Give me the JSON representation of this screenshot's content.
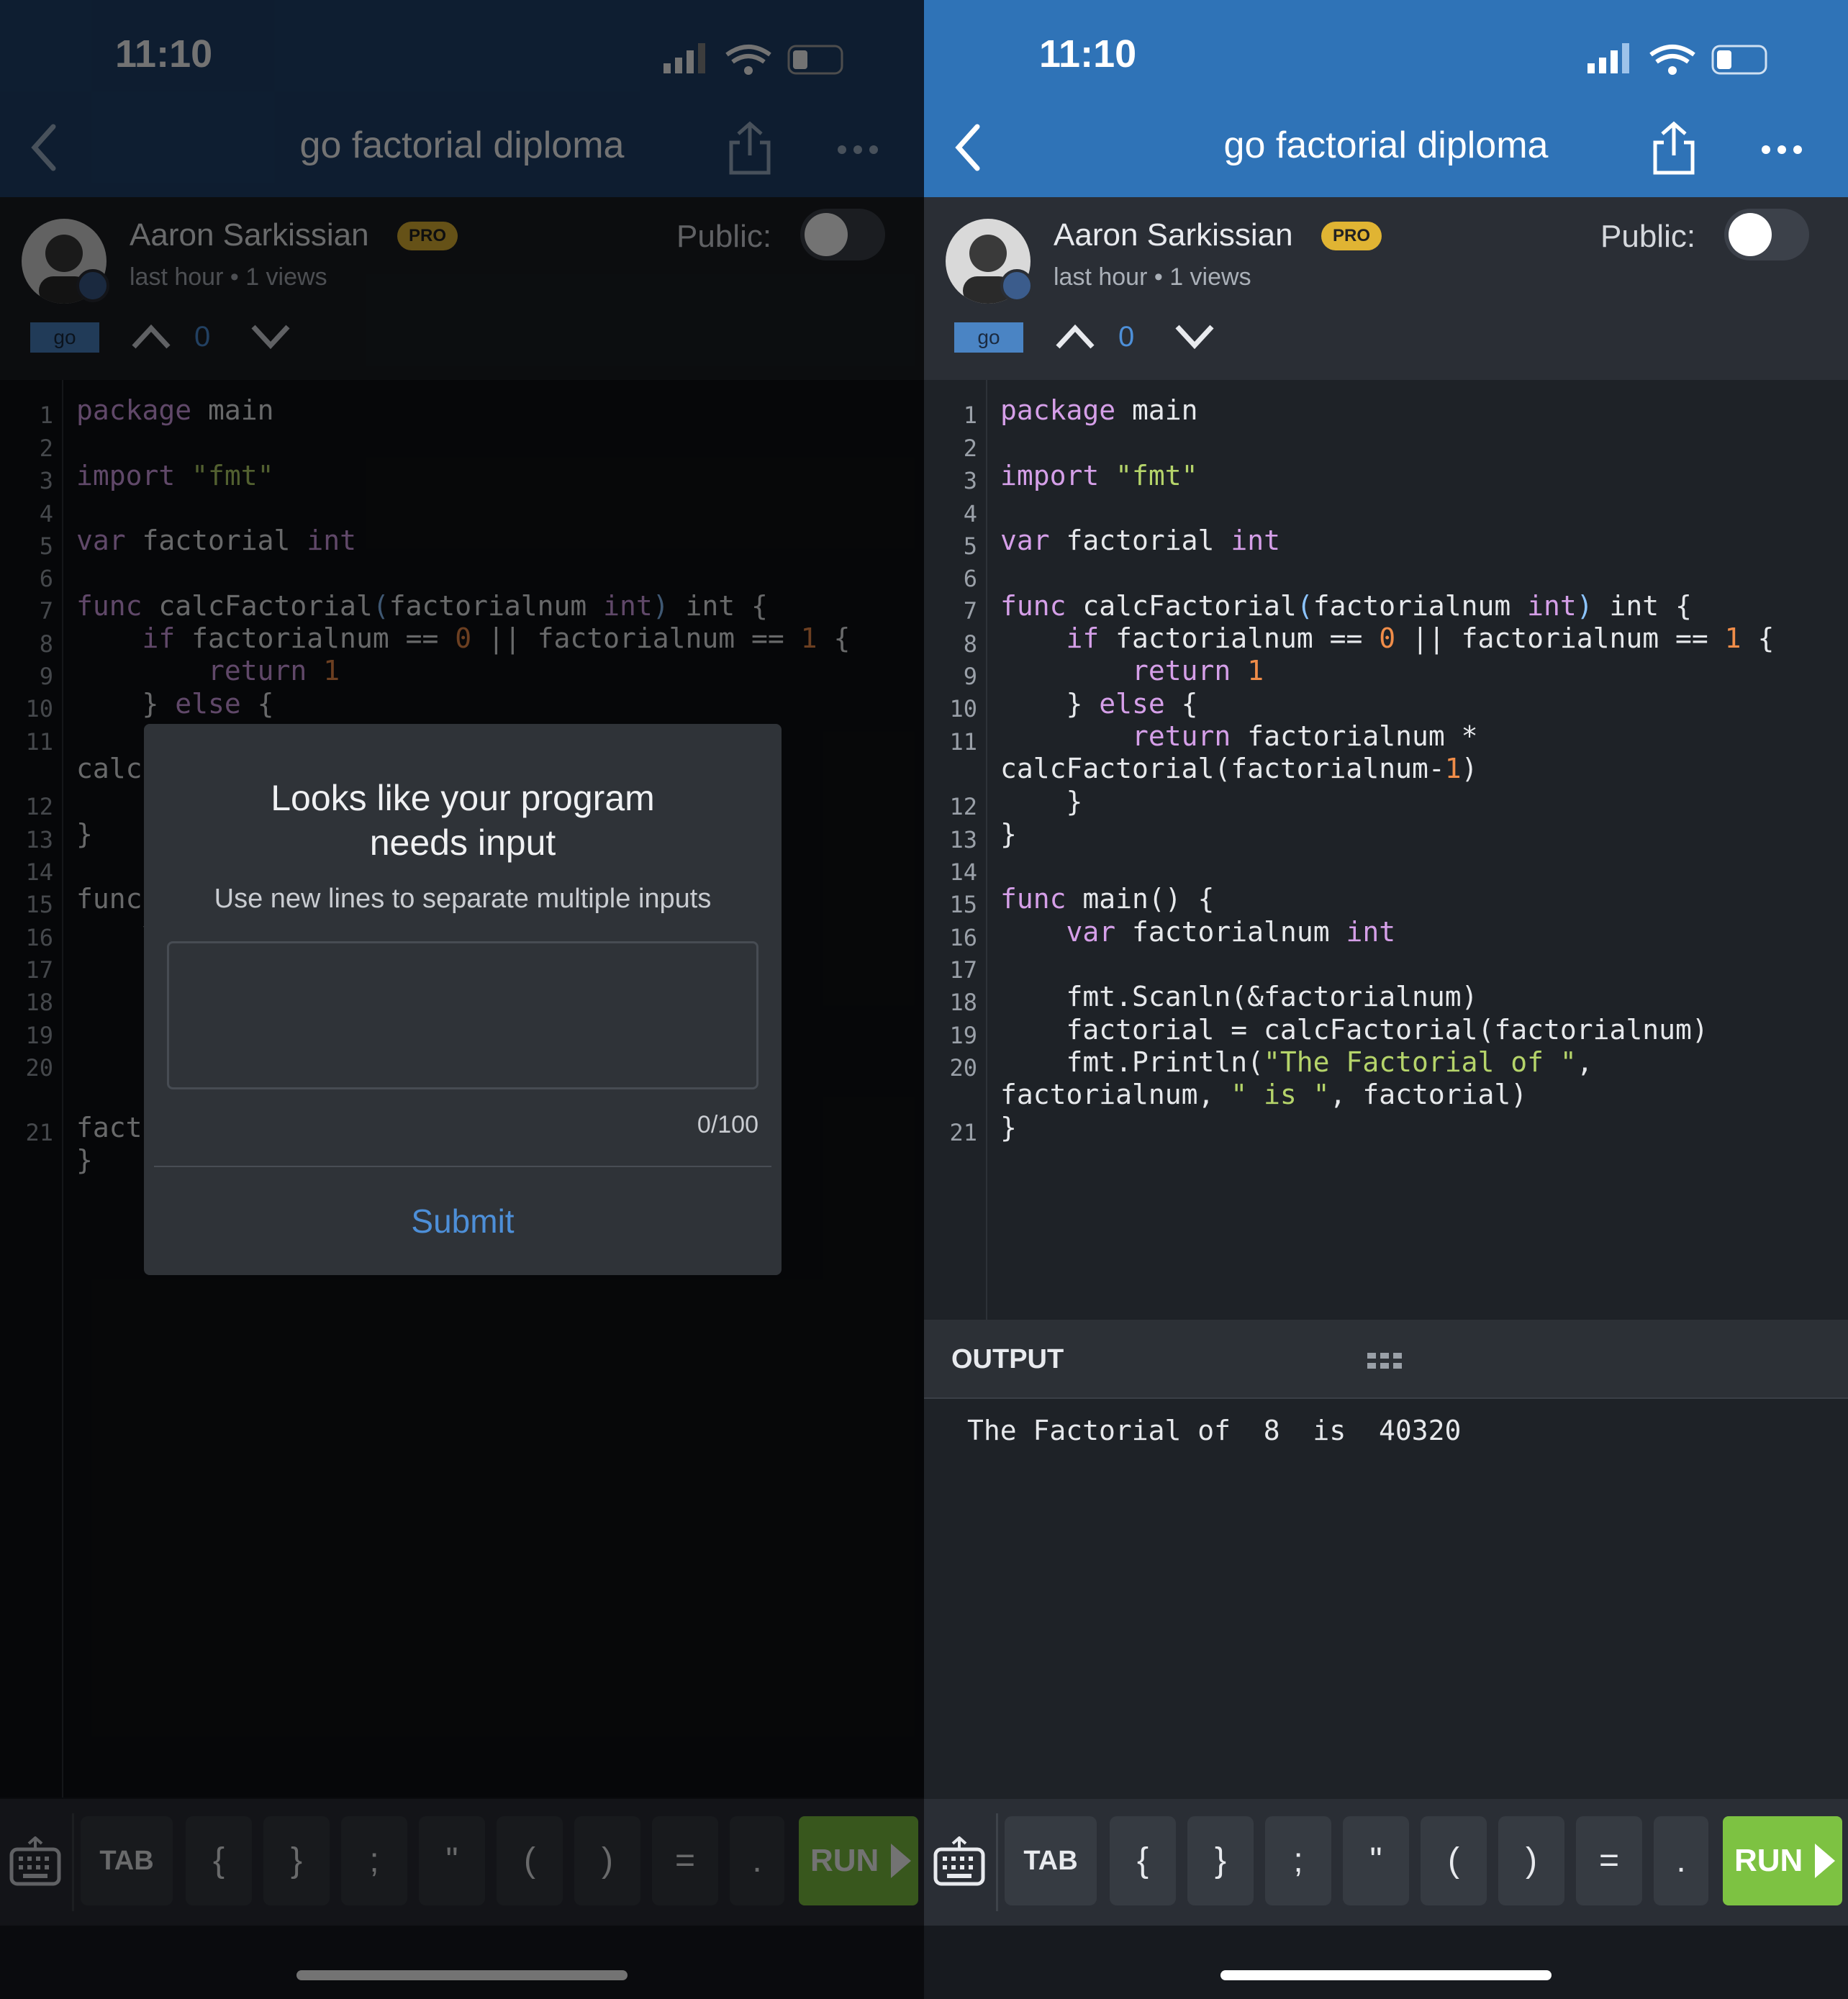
{
  "status": {
    "time": "11:10"
  },
  "nav": {
    "title": "go factorial diploma"
  },
  "author": {
    "name": "Aaron Sarkissian",
    "badge": "PRO",
    "meta": "last hour • 1 views"
  },
  "visibility": {
    "label": "Public:",
    "enabled": false
  },
  "language": "go",
  "votes": {
    "count": "0"
  },
  "editor": {
    "line_numbers": [
      "1",
      "2",
      "3",
      "4",
      "5",
      "6",
      "7",
      "8",
      "9",
      "10",
      "11",
      "12",
      "13",
      "14",
      "15",
      "16",
      "17",
      "18",
      "19",
      "20",
      "21"
    ]
  },
  "output": {
    "title": "OUTPUT",
    "text": "The Factorial of  8  is  40320"
  },
  "keyboard": {
    "keys": [
      "TAB",
      "{",
      "}",
      ";",
      "\"",
      "(",
      ")",
      "=",
      "."
    ],
    "run": "RUN"
  },
  "modal": {
    "title_line1": "Looks like your program",
    "title_line2": "needs input",
    "subtitle": "Use new lines to separate multiple inputs",
    "counter": "0/100",
    "submit": "Submit"
  },
  "colors": {
    "nav_blue": "#2f73b7",
    "run_green": "#7dc242",
    "keyword": "#d59fe8",
    "string": "#b5d46a",
    "number": "#f08d49"
  }
}
